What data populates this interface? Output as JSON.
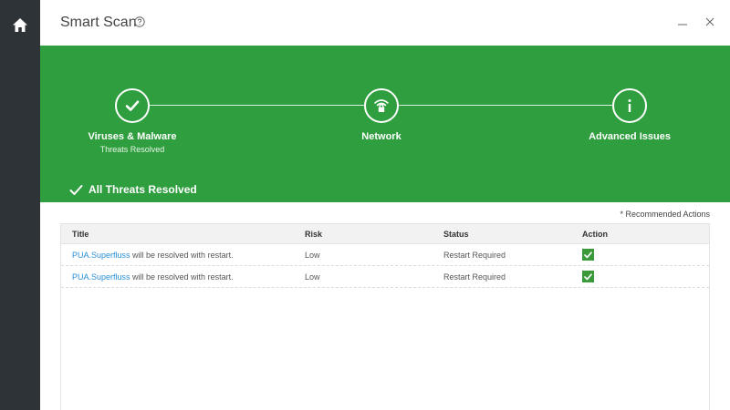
{
  "window": {
    "title": "Smart Scan"
  },
  "steps": [
    {
      "label": "Viruses & Malware",
      "sublabel": "Threats Resolved",
      "icon": "check-icon"
    },
    {
      "label": "Network",
      "sublabel": "",
      "icon": "wifi-lock-icon"
    },
    {
      "label": "Advanced Issues",
      "sublabel": "",
      "icon": "info-icon"
    }
  ],
  "banner": {
    "resolved_text": "All Threats Resolved",
    "color": "#2f9e3e"
  },
  "table": {
    "note": "* Recommended Actions",
    "headers": {
      "title": "Title",
      "risk": "Risk",
      "status": "Status",
      "action": "Action"
    },
    "rows": [
      {
        "threat": "PUA.Superfluss",
        "suffix": " will be resolved with restart.",
        "risk": "Low",
        "status": "Restart Required",
        "action_checked": true
      },
      {
        "threat": "PUA.Superfluss",
        "suffix": " will be resolved with restart.",
        "risk": "Low",
        "status": "Restart Required",
        "action_checked": true
      }
    ]
  },
  "colors": {
    "sidebar": "#2e3338",
    "accent_green": "#2f9e3e",
    "link": "#2a8fd4"
  }
}
